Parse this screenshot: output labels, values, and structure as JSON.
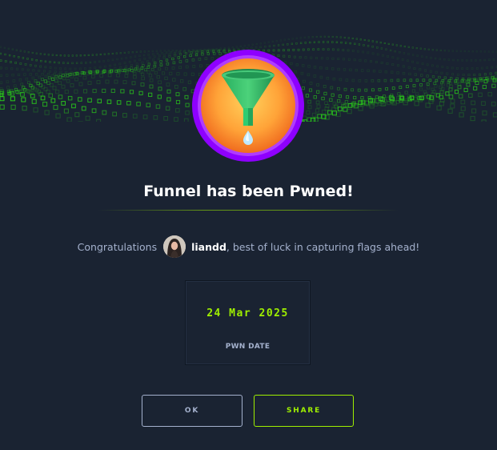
{
  "modal": {
    "title": "Funnel has been Pwned!",
    "congrats_prefix": "Congratulations",
    "username": "liandd",
    "congrats_suffix": ", best of luck in capturing flags ahead!",
    "pwn_date": "24 Mar 2025",
    "pwn_date_label": "PWN DATE",
    "ok_label": "OK",
    "share_label": "SHARE"
  },
  "icons": {
    "badge": "funnel-icon",
    "avatar": "user-avatar"
  },
  "colors": {
    "background": "#1a2332",
    "accent": "#9fef00",
    "muted_text": "#a4b1cd",
    "badge_ring": "#9f00ff",
    "badge_fill": "#f7931e",
    "funnel": "#2ecc71"
  }
}
